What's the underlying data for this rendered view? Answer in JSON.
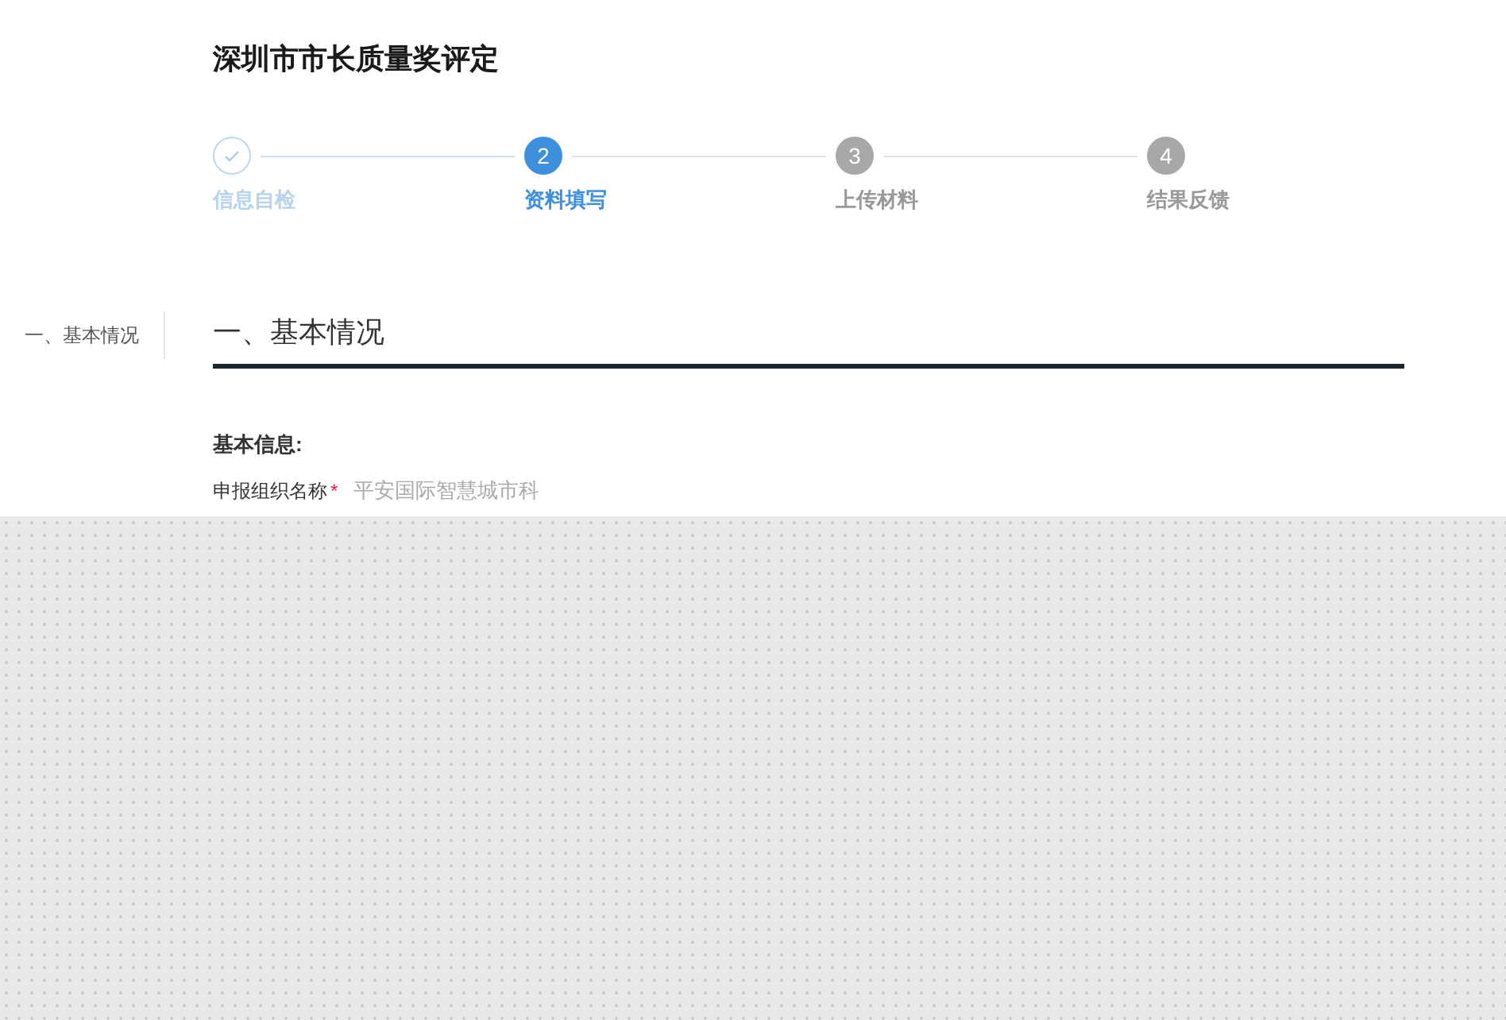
{
  "title": "深圳市市长质量奖评定",
  "steps": [
    {
      "label": "信息自检",
      "done": true,
      "selected": false
    },
    {
      "number": "2",
      "label": "资料填写",
      "done": false,
      "selected": true
    },
    {
      "number": "3",
      "label": "上传材料",
      "done": false,
      "selected": false
    },
    {
      "number": "4",
      "label": "结果反馈",
      "done": false,
      "selected": false
    }
  ],
  "side_nav": [
    {
      "label": "一、基本情况",
      "selected": true
    }
  ],
  "section": {
    "title": "一、基本情况",
    "subheading": "基本信息:",
    "fields": [
      {
        "label": "申报组织名称",
        "required_mark": "*",
        "value": "平安国际智慧城市科"
      }
    ]
  }
}
